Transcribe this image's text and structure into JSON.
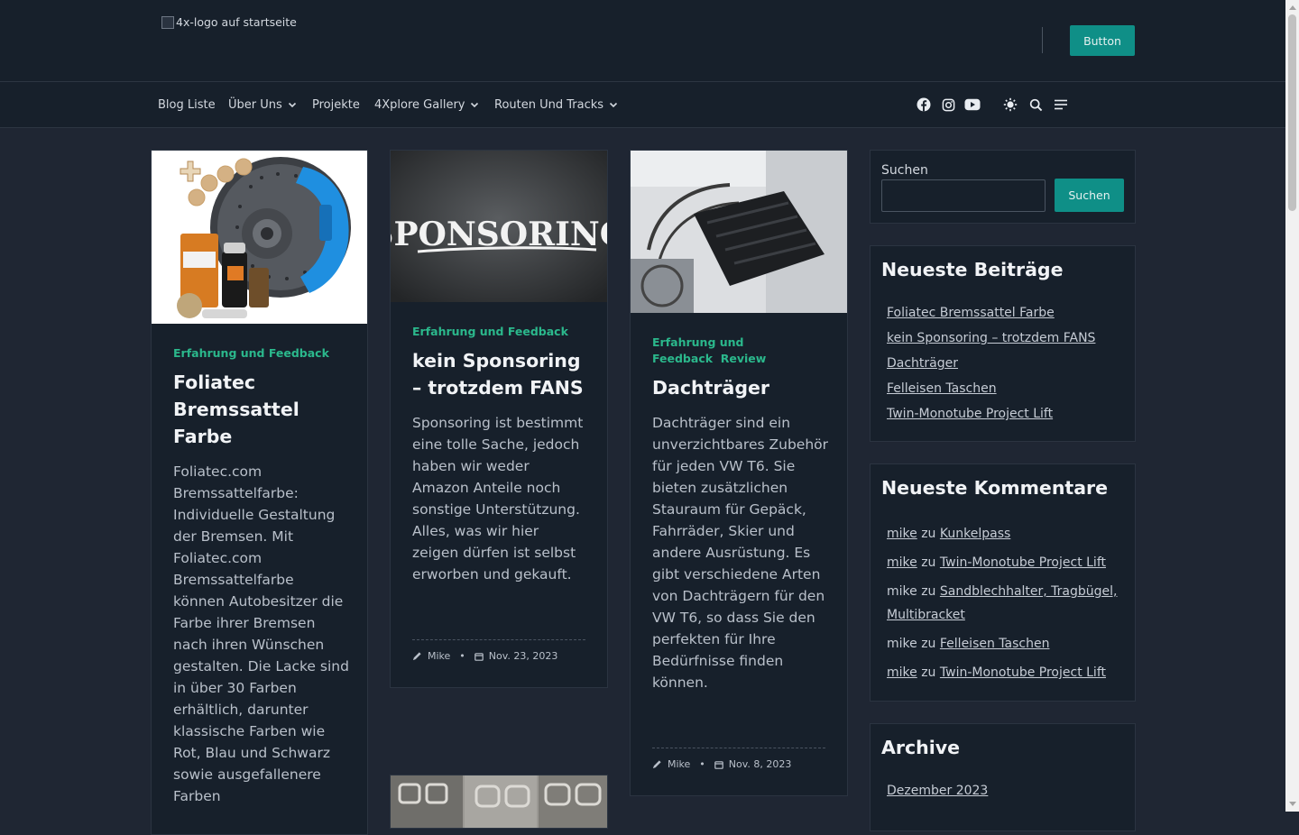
{
  "header": {
    "logo_alt": "4x-logo auf startseite",
    "button_label": "Button"
  },
  "nav": {
    "items": [
      {
        "label": "Blog Liste"
      },
      {
        "label": "Über Uns"
      },
      {
        "label": "Projekte"
      },
      {
        "label": "4Xplore Gallery"
      },
      {
        "label": "Routen Und Tracks"
      }
    ],
    "icons": [
      "facebook-icon",
      "instagram-icon",
      "youtube-icon",
      "theme-toggle-icon",
      "search-icon",
      "menu-icon"
    ]
  },
  "posts": [
    {
      "category": "Erfahrung und Feedback",
      "title": "Foliatec Bremssattel Farbe",
      "excerpt": "Foliatec.com Bremssattelfarbe: Individuelle Gestaltung der Bremsen. Mit Foliatec.com Bremssattelfarbe können Autobesitzer die Farbe ihrer Bremsen nach ihren Wünschen gestalten. Die Lacke sind in über 30 Farben erhältlich, darunter klassische Farben wie Rot, Blau und Schwarz sowie ausgefallenere Farben"
    },
    {
      "category": "Erfahrung und Feedback",
      "title": "kein Sponsoring – trotzdem FANS",
      "image_text": "SPONSORING",
      "excerpt": "Sponsoring ist bestimmt eine tolle Sache, jedoch haben wir weder Amazon Anteile noch sonstige Unterstützung. Alles, was wir hier zeigen dürfen ist selbst erworben und gekauft.",
      "author": "Mike",
      "date": "Nov. 23, 2023"
    },
    {
      "category": "Erfahrung und Feedback",
      "category2": "Review",
      "title": "Dachträger",
      "excerpt": "Dachträger sind ein unverzichtbares Zubehör für jeden VW T6. Sie bieten zusätzlichen Stauraum für Gepäck, Fahrräder, Skier und andere Ausrüstung. Es gibt verschiedene Arten von Dachträgern für den VW T6, so dass Sie den perfekten für Ihre Bedürfnisse finden können.",
      "author": "Mike",
      "date": "Nov. 8, 2023"
    }
  ],
  "sidebar": {
    "search": {
      "label": "Suchen",
      "button": "Suchen",
      "value": ""
    },
    "recent_posts": {
      "title": "Neueste Beiträge",
      "items": [
        "Foliatec Bremssattel Farbe",
        "kein Sponsoring – trotzdem FANS",
        "Dachträger",
        "Felleisen Taschen",
        "Twin-Monotube Project Lift"
      ]
    },
    "recent_comments": {
      "title": "Neueste Kommentare",
      "items": [
        {
          "author": "mike",
          "sep": "zu",
          "post": "Kunkelpass"
        },
        {
          "author": "mike",
          "sep": "zu",
          "post": "Twin-Monotube Project Lift"
        },
        {
          "author": "mike",
          "sep": "zu",
          "post": "Sandblechhalter, Tragbügel, Multibracket"
        },
        {
          "author": "mike",
          "sep": "zu",
          "post": "Felleisen Taschen"
        },
        {
          "author": "mike",
          "sep": "zu",
          "post": "Twin-Monotube Project Lift"
        }
      ]
    },
    "archive": {
      "title": "Archive",
      "items": [
        "Dezember 2023"
      ]
    }
  },
  "colors": {
    "accent": "#0f8f87",
    "category": "#2bb88c",
    "background": "#1f2633",
    "surface": "#17202b"
  }
}
